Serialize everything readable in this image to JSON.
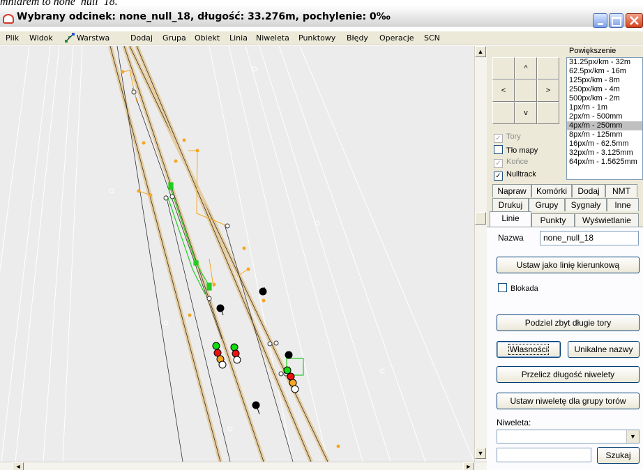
{
  "caption": {
    "prefix": "mniarem to ",
    "name": "none_null_18",
    "suffix": "."
  },
  "window": {
    "title": "Wybrany odcinek: none_null_18, długość: 33.276m, pochylenie: 0‰"
  },
  "menu": [
    "Plik",
    "Widok",
    "Warstwa",
    "Dodaj",
    "Grupa",
    "Obiekt",
    "Linia",
    "Niweleta",
    "Punktowy",
    "Błędy",
    "Operacje",
    "SCN"
  ],
  "nav": {
    "up": "^",
    "left": "<",
    "right": ">",
    "down": "v"
  },
  "zoom": {
    "label": "Powiększenie",
    "items": [
      "31.25px/km - 32m",
      "62.5px/km - 16m",
      "125px/km - 8m",
      "250px/km - 4m",
      "500px/km - 2m",
      "1px/m - 1m",
      "2px/m - 500mm",
      "4px/m - 250mm",
      "8px/m - 125mm",
      "16px/m - 62.5mm",
      "32px/m - 3.125mm",
      "64px/m - 1.5625mm"
    ],
    "selected_index": 7
  },
  "checks": [
    {
      "label": "Tory",
      "checked": true,
      "disabled": true
    },
    {
      "label": "Tło mapy",
      "checked": false,
      "disabled": false
    },
    {
      "label": "Końce",
      "checked": true,
      "disabled": true
    },
    {
      "label": "Nulltrack",
      "checked": true,
      "disabled": false
    }
  ],
  "tabs": {
    "row1": [
      "Napraw",
      "Komórki",
      "Dodaj",
      "NMT"
    ],
    "row2": [
      "Drukuj",
      "Grupy",
      "Sygnały",
      "Inne"
    ],
    "row3": [
      "Linie",
      "Punkty",
      "Wyświetlanie"
    ],
    "active": "Linie"
  },
  "linie": {
    "name_label": "Nazwa",
    "name_value": "none_null_18",
    "set_direction_button": "Ustaw jako linię kierunkową",
    "lock_label": "Blokada",
    "split_button": "Podziel zbyt długie tory",
    "properties_button": "Własności",
    "unique_names_button": "Unikalne nazwy",
    "recalc_button": "Przelicz długość niwelety",
    "set_grade_button": "Ustaw niweletę dla grupy torów",
    "grade_label": "Niweleta:",
    "grade_value": "",
    "search_value": "",
    "search_button": "Szukaj"
  },
  "scroll": {
    "up": "▲",
    "down": "▼",
    "left": "◄",
    "right": "►"
  },
  "colors": {
    "track": "#e9cf9c",
    "selection": "#22cc22",
    "orange": "#f5a623",
    "grid": "#ffffff"
  }
}
